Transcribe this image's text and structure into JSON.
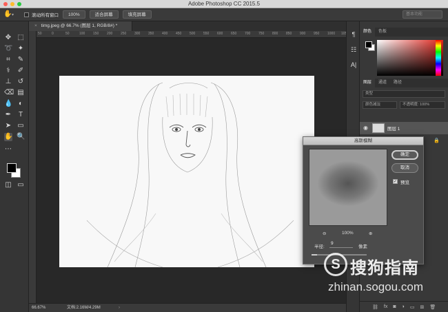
{
  "window": {
    "title": "Adobe Photoshop CC 2015.5"
  },
  "options_bar": {
    "scroll_all_label": "滚动所有窗口",
    "zoom_100": "100%",
    "fit_screen": "适合屏幕",
    "fill_screen": "填充屏幕",
    "workspace": "基本功能"
  },
  "document": {
    "tab_label": "timg.jpeg @ 66.7% (图层 1, RGB/8#) *",
    "zoom": "66.67%",
    "doc_info": "文档:2.16M/4.29M"
  },
  "ruler_ticks": [
    "50",
    "0",
    "50",
    "100",
    "150",
    "200",
    "250",
    "300",
    "350",
    "400",
    "450",
    "500",
    "550",
    "600",
    "650",
    "700",
    "750",
    "800",
    "850",
    "900",
    "950",
    "1000",
    "1050"
  ],
  "panels": {
    "color_tabs": [
      "颜色",
      "色板"
    ],
    "layer_tabs": [
      "图层",
      "通道",
      "路径"
    ],
    "filter_placeholder": "类型",
    "blend_mode": "颜色减淡",
    "opacity_label": "不透明度: 100%",
    "layers": [
      {
        "name": "图层 1"
      }
    ]
  },
  "dialog": {
    "title": "高斯模糊",
    "ok": "确定",
    "cancel": "取消",
    "preview": "预览",
    "zoom_percent": "100%",
    "radius_label": "半径:",
    "radius_value": "9",
    "radius_unit": "像素",
    "radius_fraction": 0.1
  },
  "watermark": {
    "logo_letter": "S",
    "brand": "搜狗指南",
    "url": "zhinan.sogou.com"
  },
  "colors": {
    "accent_red": "#e0241c",
    "canvas_bg": "#282828",
    "panel_bg": "#383838"
  }
}
